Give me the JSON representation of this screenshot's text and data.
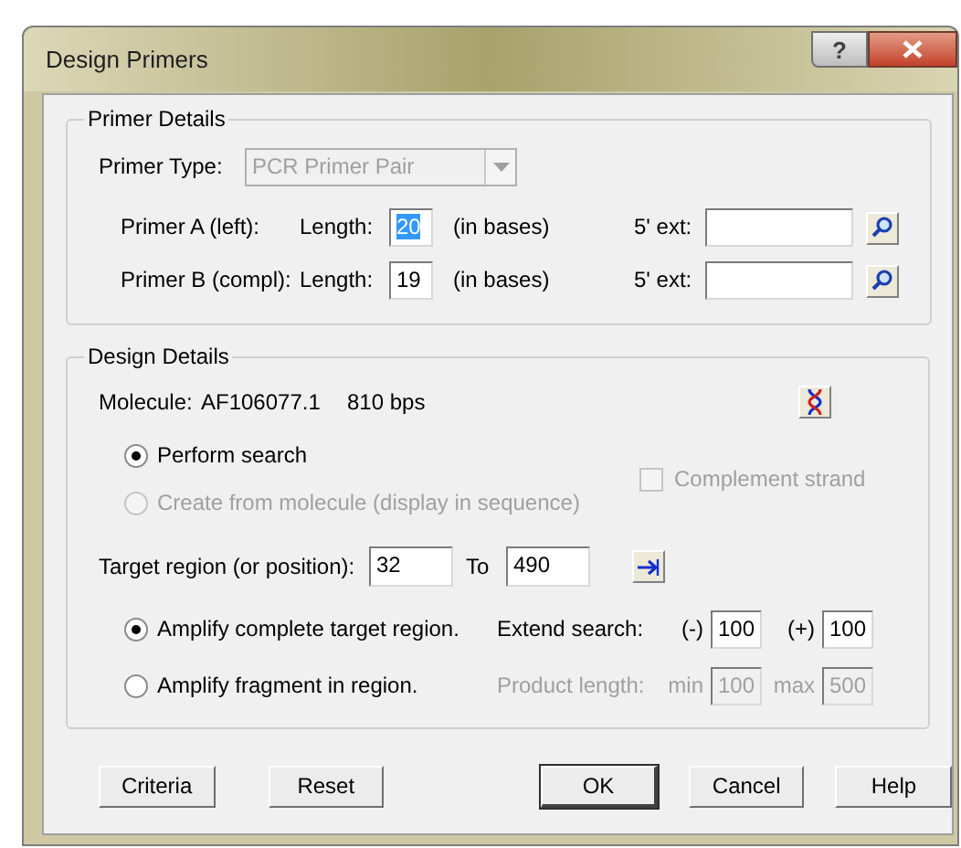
{
  "window": {
    "title": "Design Primers",
    "help_button": "?"
  },
  "primer_details": {
    "legend": "Primer Details",
    "primer_type": {
      "label": "Primer Type:",
      "value": "PCR Primer Pair",
      "disabled": true
    },
    "primers": [
      {
        "label": "Primer A (left):",
        "length_label": "Length:",
        "length": "20",
        "text_selected": true,
        "unit": "(in bases)",
        "ext_label": "5' ext:"
      },
      {
        "label": "Primer B (compl):",
        "length_label": "Length:",
        "length": "19",
        "text_selected": false,
        "unit": "(in bases)",
        "ext_label": "5' ext:"
      }
    ]
  },
  "design_details": {
    "legend": "Design Details",
    "molecule": {
      "label": "Molecule:",
      "name": "AF106077.1",
      "size": "810 bps"
    },
    "modes": [
      {
        "label": "Perform search",
        "selected": true,
        "disabled": false
      },
      {
        "label": "Create from molecule (display in sequence)",
        "selected": false,
        "disabled": true
      }
    ],
    "complement": {
      "label": "Complement strand",
      "checked": false,
      "disabled": true
    },
    "target": {
      "label": "Target region (or position):",
      "from": "32",
      "to_label": "To",
      "to": "490"
    },
    "amplify": [
      {
        "label": "Amplify complete target region.",
        "selected": true
      },
      {
        "label": "Amplify fragment in region.",
        "selected": false
      }
    ],
    "extend": {
      "label": "Extend search:",
      "minus_label": "(-)",
      "minus": "100",
      "plus_label": "(+)",
      "plus": "100",
      "disabled": false
    },
    "product_length": {
      "label": "Product length:",
      "min_label": "min",
      "min": "100",
      "max_label": "max",
      "max": "500",
      "disabled": true
    }
  },
  "buttons": [
    {
      "label": "Criteria",
      "default": false
    },
    {
      "label": "Reset",
      "default": false
    },
    {
      "label": "OK",
      "default": true
    },
    {
      "label": "Cancel",
      "default": false
    },
    {
      "label": "Help",
      "default": false
    }
  ]
}
